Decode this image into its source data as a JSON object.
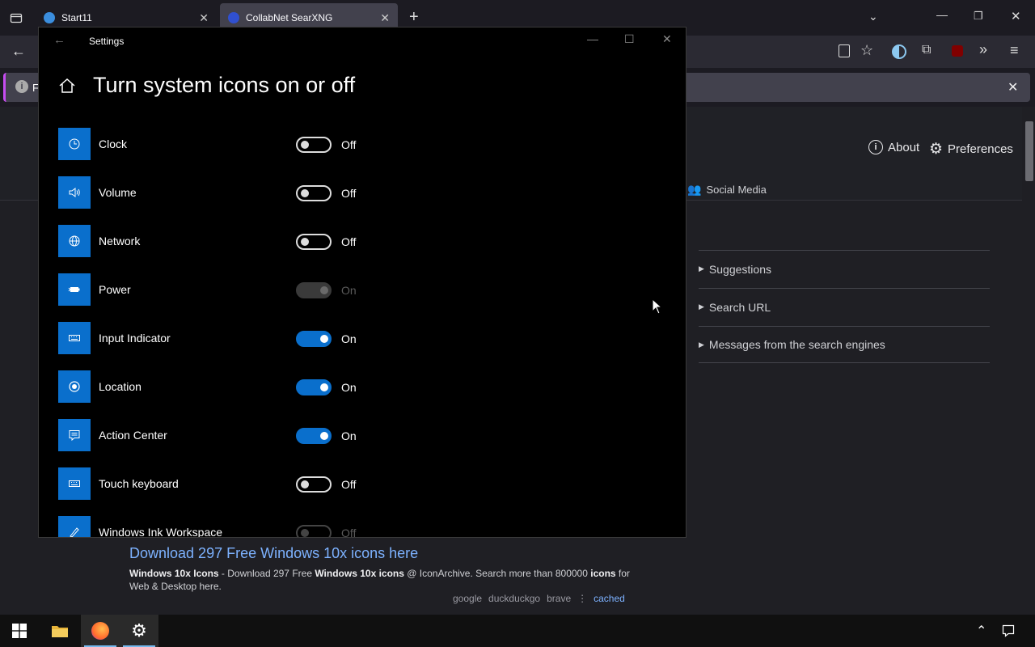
{
  "browser": {
    "tabs": [
      {
        "label": "Start11"
      },
      {
        "label": "CollabNet SearXNG"
      }
    ],
    "notification_prefix": "F"
  },
  "searxng": {
    "about_label": "About",
    "preferences_label": "Preferences",
    "social_media_label": "Social Media",
    "details": [
      {
        "label": "Suggestions"
      },
      {
        "label": "Search URL"
      },
      {
        "label": "Messages from the search engines"
      }
    ],
    "result": {
      "title": "Download 297 Free Windows 10x icons here",
      "desc_b1": "Windows 10x Icons",
      "desc_t1": " - Download 297 Free ",
      "desc_b2": "Windows 10x icons",
      "desc_t2": " @ IconArchive. Search more than 800000 ",
      "desc_b3": "icons",
      "desc_t3": " for Web & Desktop here.",
      "engines": [
        "google",
        "duckduckgo",
        "brave"
      ],
      "separator": "⋮",
      "cached": "cached"
    }
  },
  "settings": {
    "window_title": "Settings",
    "page_title": "Turn system icons on or off",
    "items": [
      {
        "label": "Clock",
        "state": "Off"
      },
      {
        "label": "Volume",
        "state": "Off"
      },
      {
        "label": "Network",
        "state": "Off"
      },
      {
        "label": "Power",
        "state": "On"
      },
      {
        "label": "Input Indicator",
        "state": "On"
      },
      {
        "label": "Location",
        "state": "On"
      },
      {
        "label": "Action Center",
        "state": "On"
      },
      {
        "label": "Touch keyboard",
        "state": "Off"
      },
      {
        "label": "Windows Ink Workspace",
        "state": "Off"
      }
    ]
  },
  "colors": {
    "accent": "#0a6fcc",
    "link": "#7db2ff"
  }
}
